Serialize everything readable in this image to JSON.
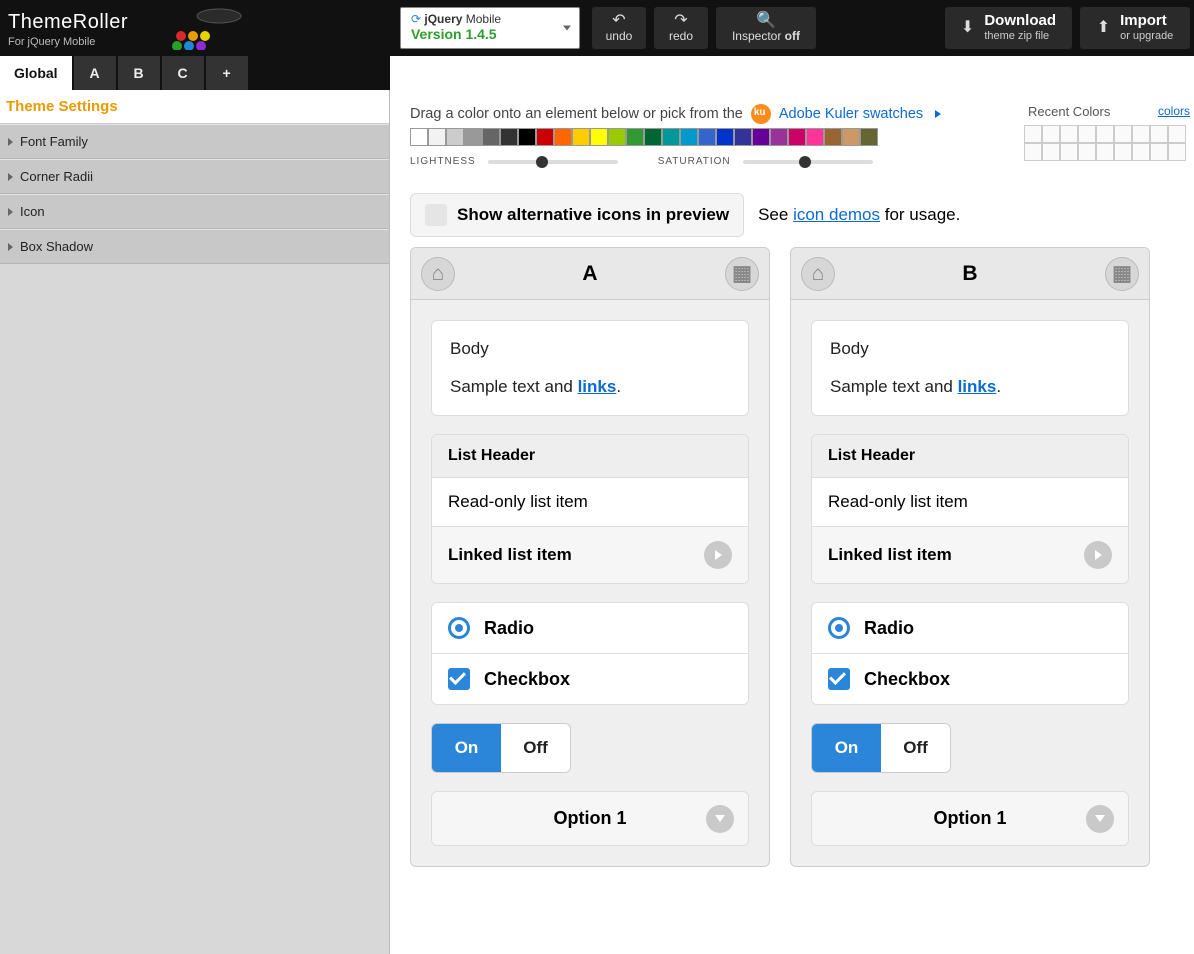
{
  "header": {
    "logo_title": "ThemeRoller",
    "logo_sub": "For jQuery Mobile",
    "version_prefix": "jQuery",
    "version_mobile": "Mobile",
    "version_label": "Version 1.4.5",
    "undo": "undo",
    "redo": "redo",
    "inspector": "Inspector",
    "inspector_state": "off",
    "download_t": "Download",
    "download_s": "theme zip file",
    "import_t": "Import",
    "import_s": "or upgrade"
  },
  "tabs": [
    "Global",
    "A",
    "B",
    "C",
    "+"
  ],
  "active_tab": 0,
  "sidebar": {
    "title": "Theme Settings",
    "items": [
      "Font Family",
      "Corner Radii",
      "Icon",
      "Box Shadow"
    ]
  },
  "colorbar": {
    "drag_text": "Drag a color onto an element below or pick from the",
    "kuler_link": "Adobe Kuler swatches",
    "swatch_colors": [
      "#ffffff",
      "#f2f2f2",
      "#cccccc",
      "#999999",
      "#666666",
      "#333333",
      "#000000",
      "#cc0000",
      "#ff6600",
      "#ffcc00",
      "#ffff00",
      "#99cc00",
      "#339933",
      "#006633",
      "#009999",
      "#0099cc",
      "#3366cc",
      "#0033cc",
      "#333399",
      "#660099",
      "#993399",
      "#cc0066",
      "#ff3399",
      "#996633",
      "#cc9966",
      "#666633"
    ],
    "lightness": "LIGHTNESS",
    "saturation": "SATURATION",
    "recent_title": "Recent Colors",
    "recent_link": "colors"
  },
  "altbar": {
    "label": "Show alternative icons in preview",
    "see": "See",
    "link": "icon demos",
    "tail": "for usage."
  },
  "preview": {
    "body_h": "Body",
    "sample_pre": "Sample text and ",
    "links": "links",
    "list_header": "List Header",
    "readonly": "Read-only list item",
    "linked": "Linked list item",
    "radio": "Radio",
    "checkbox": "Checkbox",
    "on": "On",
    "off": "Off",
    "option1": "Option 1",
    "columns": [
      "A",
      "B"
    ]
  }
}
